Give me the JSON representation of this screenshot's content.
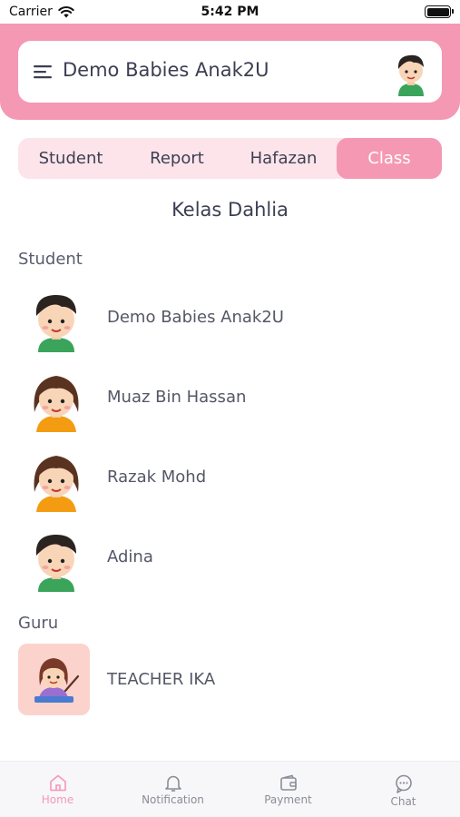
{
  "status_bar": {
    "carrier": "Carrier",
    "time": "5:42 PM"
  },
  "header": {
    "title": "Demo Babies Anak2U"
  },
  "tabs": [
    {
      "label": "Student"
    },
    {
      "label": "Report"
    },
    {
      "label": "Hafazan"
    },
    {
      "label": "Class"
    }
  ],
  "active_tab": "Class",
  "class_name": "Kelas Dahlia",
  "students_section": {
    "label": "Student",
    "items": [
      {
        "name": "Demo Babies Anak2U",
        "avatar": "boy-avatar"
      },
      {
        "name": "Muaz Bin Hassan",
        "avatar": "girl-avatar"
      },
      {
        "name": "Razak Mohd",
        "avatar": "girl-avatar"
      },
      {
        "name": "Adina",
        "avatar": "boy-avatar"
      }
    ]
  },
  "guru_section": {
    "label": "Guru",
    "items": [
      {
        "name": "TEACHER IKA",
        "avatar": "teacher-avatar"
      }
    ]
  },
  "bottom_nav": [
    {
      "label": "Home",
      "icon": "home-icon",
      "active": true
    },
    {
      "label": "Notification",
      "icon": "bell-icon",
      "active": false
    },
    {
      "label": "Payment",
      "icon": "wallet-icon",
      "active": false
    },
    {
      "label": "Chat",
      "icon": "chat-icon",
      "active": false
    }
  ],
  "colors": {
    "accent": "#f598b4",
    "tab_bg": "#fde4eb",
    "text": "#3c3f52",
    "guru_tile": "#fbd3cc"
  }
}
